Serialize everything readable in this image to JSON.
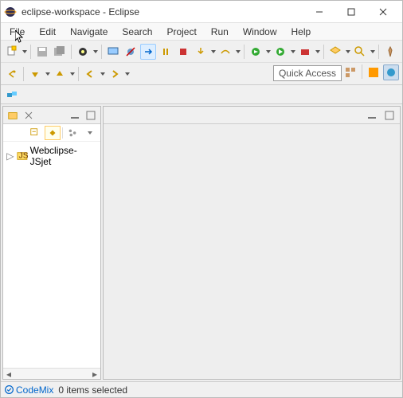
{
  "window": {
    "title": "eclipse-workspace - Eclipse"
  },
  "menu": {
    "file": "File",
    "edit": "Edit",
    "navigate": "Navigate",
    "search": "Search",
    "project": "Project",
    "run": "Run",
    "window": "Window",
    "help": "Help"
  },
  "quick_access": {
    "label": "Quick Access"
  },
  "explorer": {
    "items": [
      {
        "label": "Webclipse-JSjet"
      }
    ]
  },
  "status": {
    "codemix": "CodeMix",
    "selection": "0 items selected"
  }
}
